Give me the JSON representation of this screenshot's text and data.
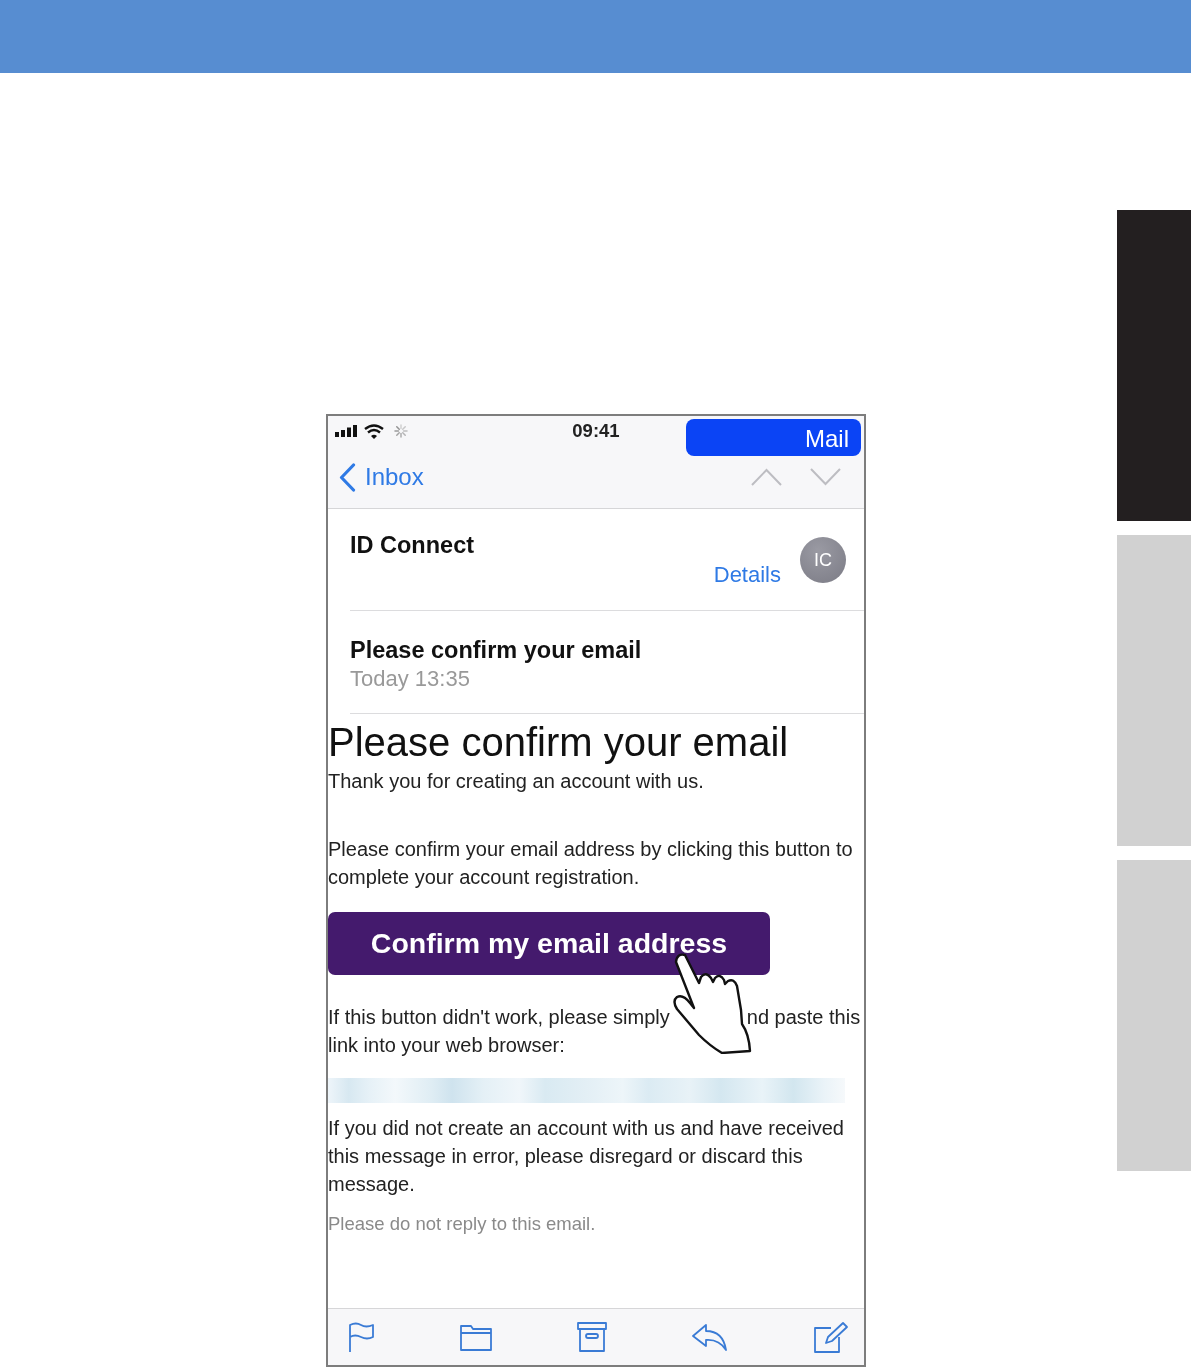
{
  "status_bar": {
    "time": "09:41",
    "return_app": "Mail"
  },
  "nav_bar": {
    "back_label": "Inbox"
  },
  "sender": {
    "name": "ID Connect",
    "details_link": "Details",
    "avatar_initials": "IC"
  },
  "subject": {
    "title": "Please confirm your email",
    "date": "Today 13:35"
  },
  "message_body": [
    {
      "kind": "heading",
      "text": "Please confirm your email"
    },
    {
      "kind": "paragraph",
      "text": "Thank you for creating an account with us."
    },
    {
      "kind": "paragraph",
      "text": "Please confirm your email address by clicking this button to complete your account registration."
    },
    {
      "kind": "button",
      "text": "Confirm my email address"
    },
    {
      "kind": "covered_paragraph",
      "before": "If this button didn't work, please simply",
      "after": "nd paste this link into your web browser:"
    },
    {
      "kind": "blurred_link"
    },
    {
      "kind": "paragraph",
      "text": "If you did not create an account with us and have received this message in error, please disregard or discard this message."
    },
    {
      "kind": "note",
      "text": "Please do not reply to this email."
    }
  ],
  "side_tabs": [
    {
      "selected": true
    },
    {
      "selected": false
    },
    {
      "selected": false
    }
  ]
}
